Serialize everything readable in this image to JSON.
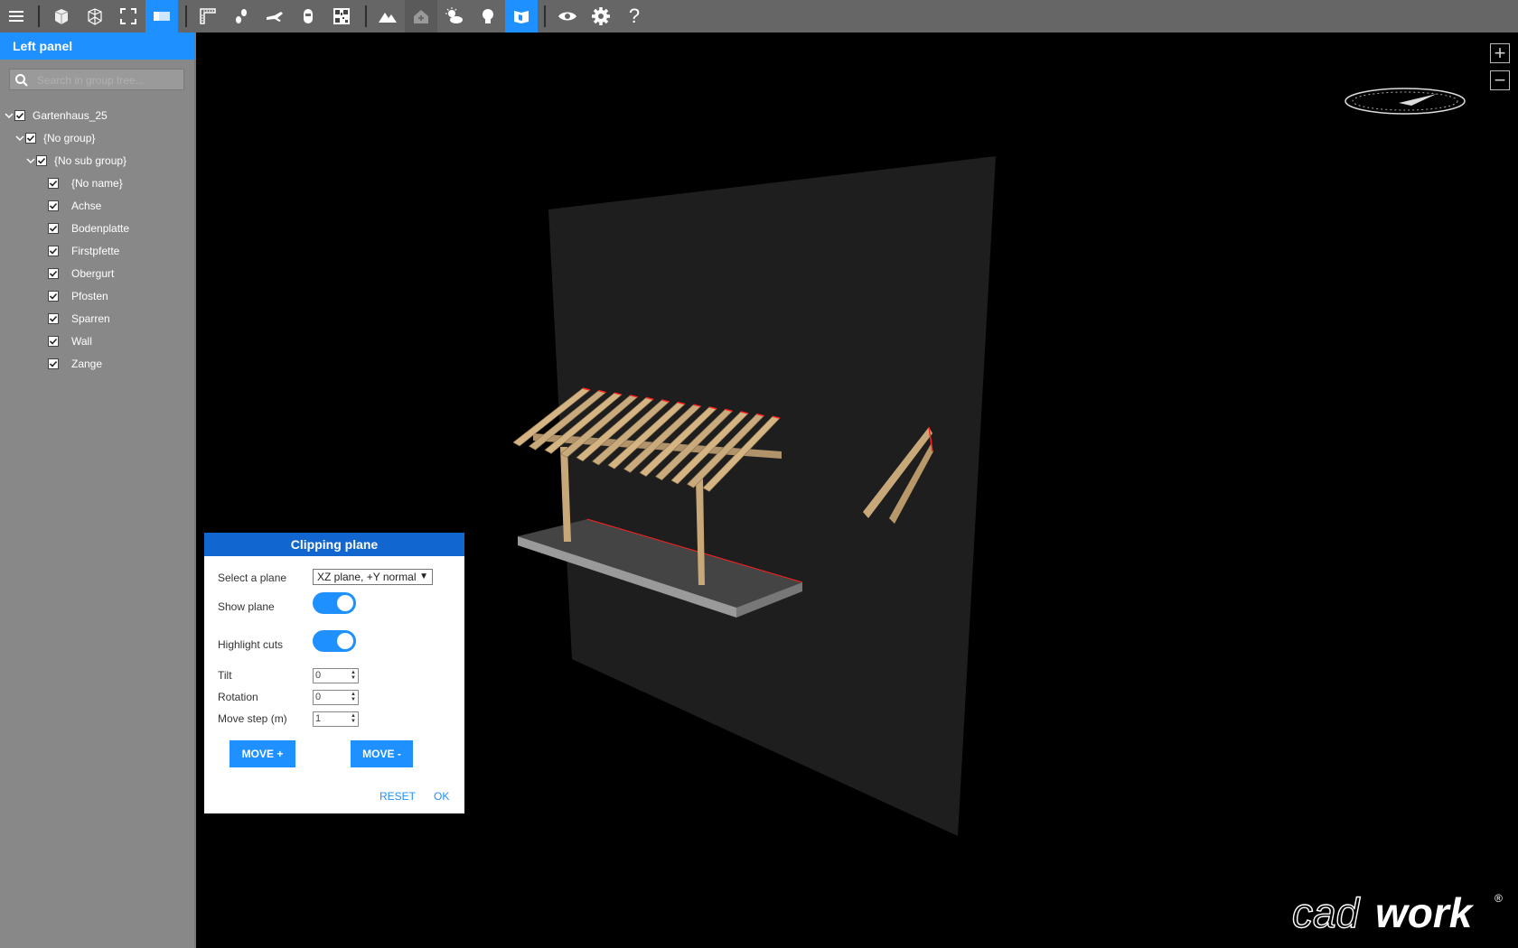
{
  "toolbar": {
    "icons": [
      "menu-icon",
      "solid-cube-icon",
      "wireframe-cube-icon",
      "fullscreen-icon",
      "clipping-plane-icon",
      "measure-icon",
      "walk-icon",
      "fly-icon",
      "vr-headset-icon",
      "qr-code-icon",
      "terrain-icon",
      "house-icon",
      "weather-icon",
      "light-bulb-icon",
      "layer-panel-icon",
      "eye-icon",
      "gear-icon",
      "help-icon"
    ],
    "help_label": "?"
  },
  "left_panel": {
    "title": "Left panel",
    "search_placeholder": "Search in group tree...",
    "tree": [
      {
        "label": "Gartenhaus_25",
        "level": 0,
        "expanded": true,
        "checked": true
      },
      {
        "label": "{No group}",
        "level": 1,
        "expanded": true,
        "checked": true
      },
      {
        "label": "{No sub group}",
        "level": 2,
        "expanded": true,
        "checked": true
      },
      {
        "label": "{No name}",
        "level": 3,
        "checked": true
      },
      {
        "label": "Achse",
        "level": 3,
        "checked": true
      },
      {
        "label": "Bodenplatte",
        "level": 3,
        "checked": true
      },
      {
        "label": "Firstpfette",
        "level": 3,
        "checked": true
      },
      {
        "label": "Obergurt",
        "level": 3,
        "checked": true
      },
      {
        "label": "Pfosten",
        "level": 3,
        "checked": true
      },
      {
        "label": "Sparren",
        "level": 3,
        "checked": true
      },
      {
        "label": "Wall",
        "level": 3,
        "checked": true
      },
      {
        "label": "Zange",
        "level": 3,
        "checked": true
      }
    ]
  },
  "viewport": {
    "zoom_in": "+",
    "zoom_out": "−"
  },
  "clipping_dialog": {
    "title": "Clipping plane",
    "select_label": "Select a plane",
    "select_value": "XZ plane, +Y normal",
    "show_plane_label": "Show plane",
    "show_plane": true,
    "highlight_cuts_label": "Highlight cuts",
    "highlight_cuts": true,
    "tilt_label": "Tilt",
    "tilt_value": "0",
    "rotation_label": "Rotation",
    "rotation_value": "0",
    "move_step_label": "Move step (m)",
    "move_step_value": "1",
    "move_plus": "MOVE +",
    "move_minus": "MOVE -",
    "reset": "RESET",
    "ok": "OK"
  },
  "logo": {
    "text_light": "cad",
    "text_bold": "work",
    "reg": "®"
  },
  "colors": {
    "accent": "#1e90ff",
    "toolbar": "#666666",
    "panel": "#888888",
    "dialog_header": "#1266d0",
    "timber": "#c8a878",
    "cut_highlight": "#ff2020"
  }
}
